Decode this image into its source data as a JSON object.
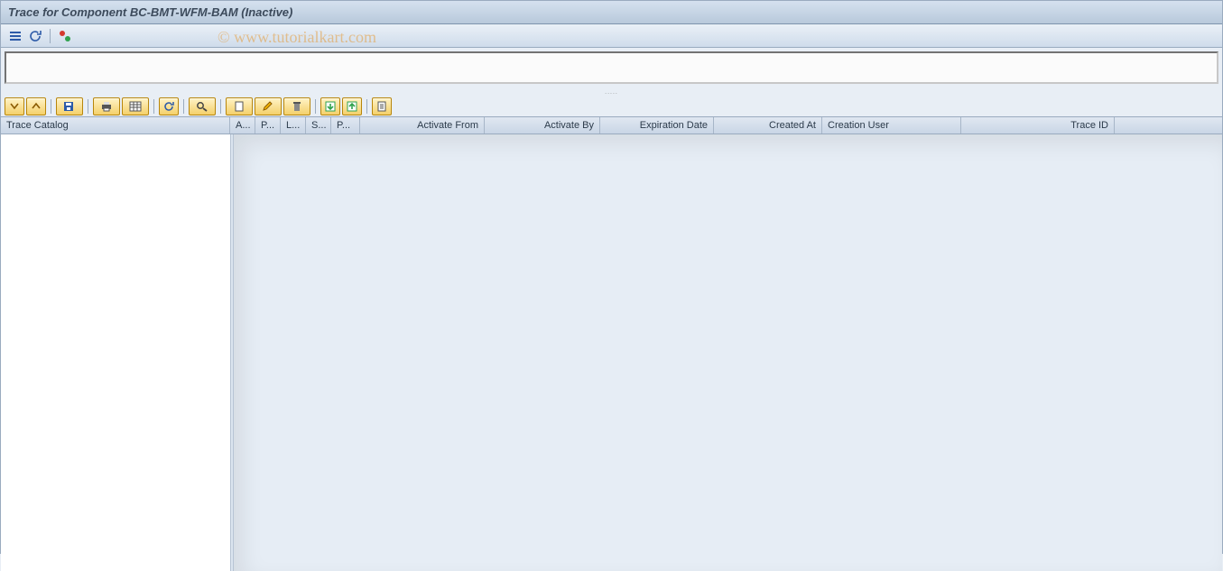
{
  "header": {
    "title": "Trace for Component BC-BMT-WFM-BAM (Inactive)"
  },
  "watermark": "© www.tutorialkart.com",
  "appToolbar": {
    "icons": {
      "list": "list-icon",
      "refresh": "refresh-icon",
      "status": "status-icon"
    }
  },
  "drag_hint": ".....",
  "alvToolbar": {
    "buttons": [
      {
        "name": "details",
        "label": ""
      },
      {
        "name": "collapse",
        "label": ""
      },
      {
        "name": "save-layout",
        "label": ""
      },
      {
        "name": "print",
        "label": ""
      },
      {
        "name": "export",
        "label": ""
      },
      {
        "name": "refresh-grid",
        "label": ""
      },
      {
        "name": "find",
        "label": ""
      },
      {
        "name": "create",
        "label": ""
      },
      {
        "name": "change",
        "label": ""
      },
      {
        "name": "delete",
        "label": ""
      },
      {
        "name": "import",
        "label": ""
      },
      {
        "name": "export2",
        "label": ""
      },
      {
        "name": "log",
        "label": ""
      }
    ]
  },
  "columns": {
    "trace_catalog": "Trace Catalog",
    "c_a": "A...",
    "c_p1": "P...",
    "c_l": "L...",
    "c_s": "S...",
    "c_p2": "P...",
    "activate_from": "Activate From",
    "activate_by": "Activate By",
    "expiration_date": "Expiration Date",
    "created_at": "Created At",
    "creation_user": "Creation User",
    "trace_id": "Trace ID"
  },
  "rows": []
}
